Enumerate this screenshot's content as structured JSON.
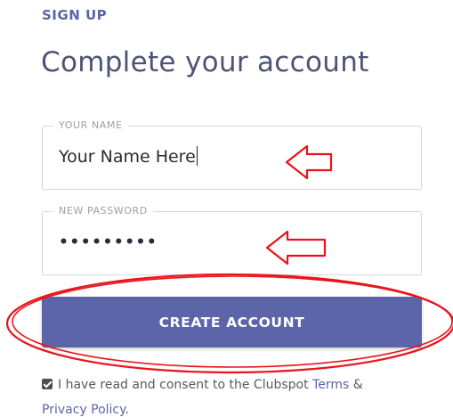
{
  "header": {
    "eyebrow": "SIGN UP",
    "title": "Complete your account"
  },
  "form": {
    "name_field": {
      "label": "YOUR NAME",
      "value": "Your Name Here"
    },
    "password_field": {
      "label": "NEW PASSWORD",
      "value": "•••••••••"
    },
    "submit_label": "CREATE ACCOUNT",
    "consent": {
      "checked": true,
      "text": "I have read and consent to the Clubspot",
      "terms_link": "Terms",
      "ampersand": "&",
      "privacy_link": "Privacy Policy",
      "period": "."
    }
  },
  "colors": {
    "accent": "#5d65aa",
    "annotation": "#e8141c"
  },
  "icons": {
    "annotation_arrow": "left-arrow-outline-icon",
    "annotation_ellipse": "ellipse-highlight"
  }
}
